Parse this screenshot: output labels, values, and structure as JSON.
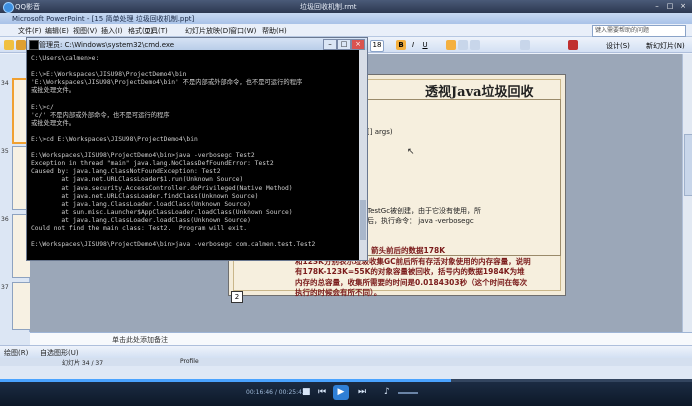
{
  "player": {
    "app_name": "QQ影音",
    "file_name": "垃圾回收机制.rmt",
    "time_current": "00:16:46",
    "time_total": "00:25:43",
    "progress_fraction": 0.652
  },
  "ppt": {
    "title": "Microsoft PowerPoint - [15 简单处理 垃圾回收机制.ppt]",
    "menu": [
      "文件(F)",
      "编辑(E)",
      "视图(V)",
      "插入(I)",
      "格式(O)",
      "工具(T)",
      "幻灯片放映(D)",
      "窗口(W)",
      "帮助(H)"
    ],
    "help_placeholder": "键入需要帮助的问题",
    "font_size": "18",
    "design_label": "设计(S)",
    "new_slide_label": "新幻灯片(N)",
    "thumb_numbers": [
      "34",
      "35",
      "36",
      "37"
    ],
    "notes_placeholder": "单击此处添加备注",
    "draw_label": "绘图(R)",
    "autoshape_label": "自选图形(U)",
    "status_slide": "幻灯片 34 / 37",
    "status_template": "Profile",
    "status_lang": "中文(中国)"
  },
  "slide": {
    "title": "透视Java垃圾回收",
    "code": "h(String[] args)",
    "highlight": "0.",
    "para1": "新的对象TestGc被创建，由于它没有使用，所\n程序编译后，执行命令： java -verbosegc",
    "para2": "2000 + JDK1.5.1，箭头前后的数据178K\n和123K分别表示垃圾收集GC前后所有存活对象使用的内存容量，说明\n有178K-123K=55K的对象容量被回收，括号内的数据1984K为堆\n内存的总容量，收集所需要的时间是0.0184303秒（这个时间在每次\n执行的时候会有所不同）。",
    "page_box": "2"
  },
  "cmd": {
    "title": "管理员: C:\\Windows\\system32\\cmd.exe",
    "lines": [
      "C:\\Users\\calmen>e:",
      "",
      "E:\\>E:\\Workspaces\\JISU98\\ProjectDemo4\\bin",
      "'E:\\Workspaces\\JISU98\\ProjectDemo4\\bin' 不是内部或外部命令，也不是可运行的程序",
      "或批处理文件。",
      "",
      "E:\\>c/",
      "'c/' 不是内部或外部命令，也不是可运行的程序",
      "或批处理文件。",
      "",
      "E:\\>cd E:\\Workspaces\\JISU98\\ProjectDemo4\\bin",
      "",
      "E:\\Workspaces\\JISU98\\ProjectDemo4\\bin>java -verbosegc Test2",
      "Exception in thread \"main\" java.lang.NoClassDefFoundError: Test2",
      "Caused by: java.lang.ClassNotFoundException: Test2",
      "        at java.net.URLClassLoader$1.run(Unknown Source)",
      "        at java.security.AccessController.doPrivileged(Native Method)",
      "        at java.net.URLClassLoader.findClass(Unknown Source)",
      "        at java.lang.ClassLoader.loadClass(Unknown Source)",
      "        at sun.misc.Launcher$AppClassLoader.loadClass(Unknown Source)",
      "        at java.lang.ClassLoader.loadClass(Unknown Source)",
      "Could not find the main class: Test2.  Program will exit.",
      "",
      "E:\\Workspaces\\JISU98\\ProjectDemo4\\bin>java -verbosegc com.calmen.test.Test2"
    ]
  },
  "colors": {
    "cmd_bg": "#000000",
    "slide_bg": "#f4ecd9",
    "player_accent": "#2f7fd6"
  }
}
